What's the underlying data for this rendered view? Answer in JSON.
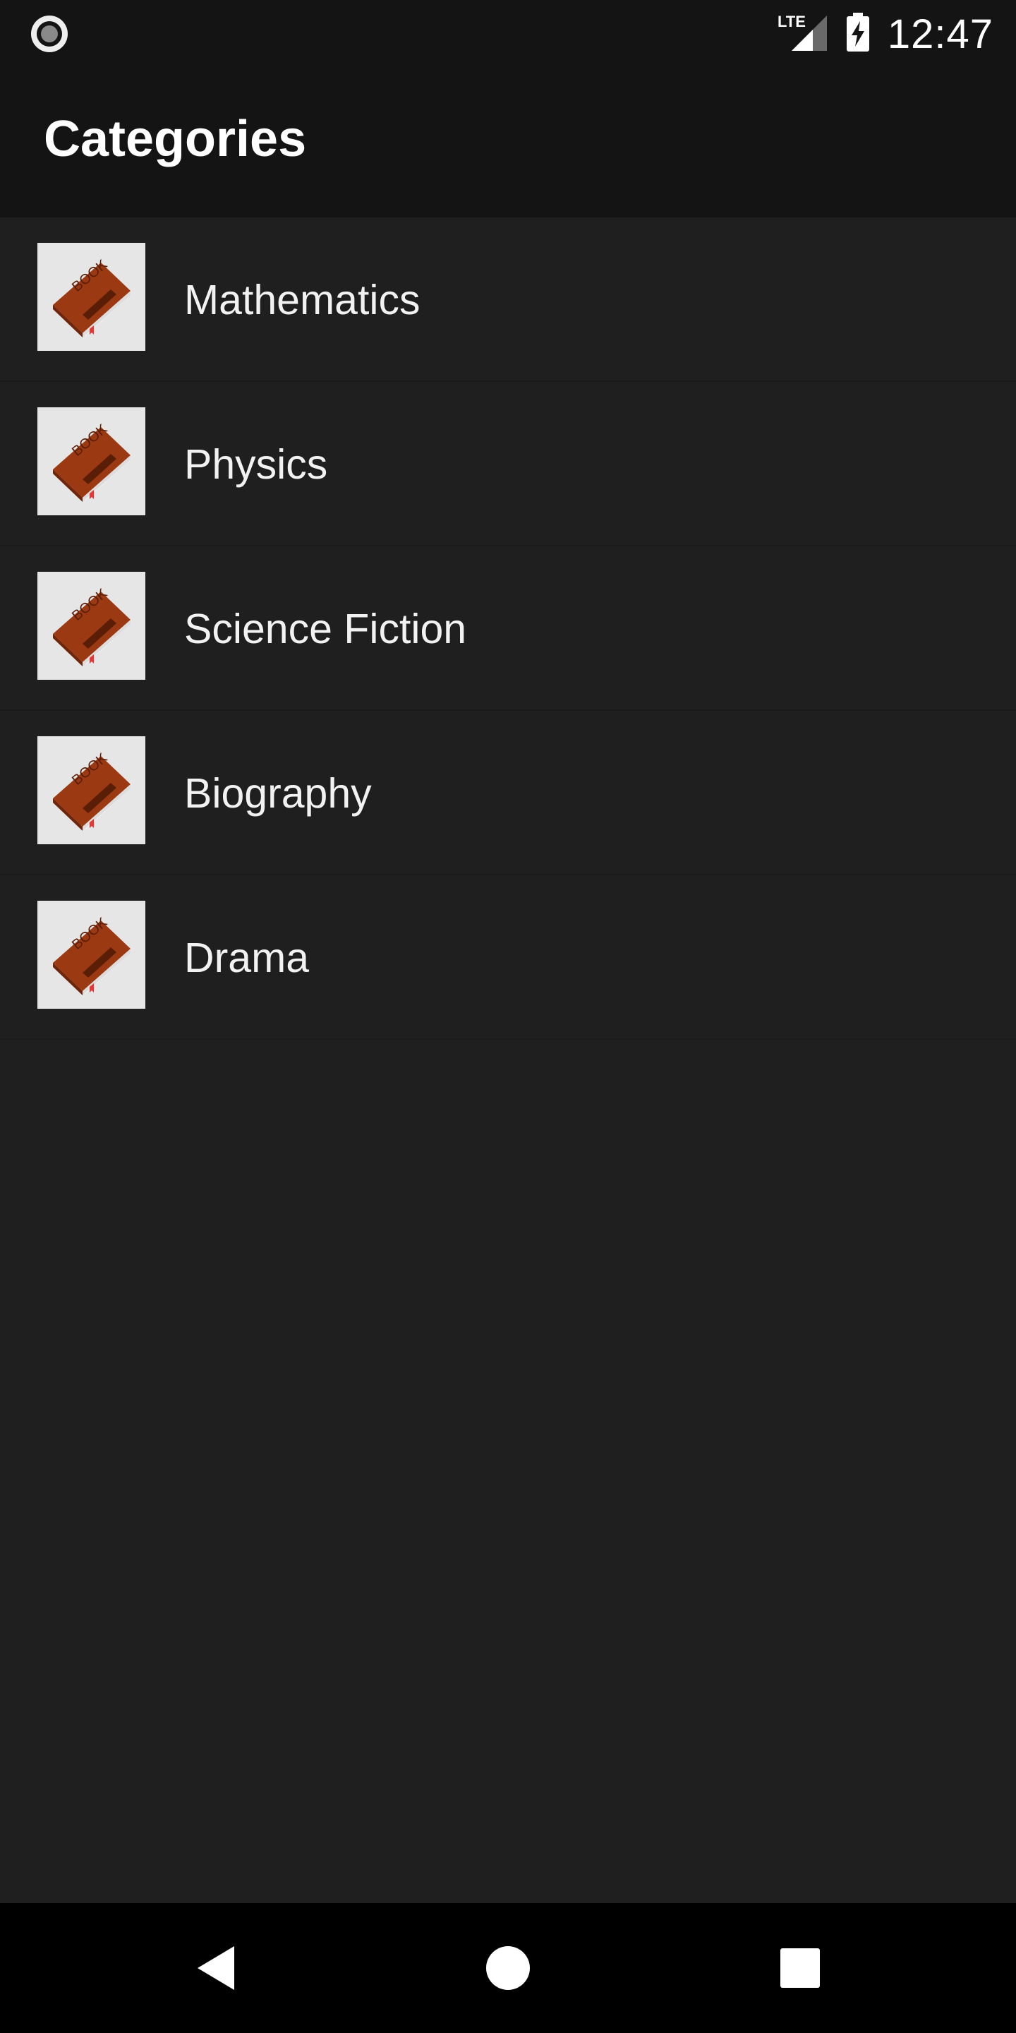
{
  "status_bar": {
    "time": "12:47",
    "network": "LTE",
    "icons": [
      "record-icon",
      "lte-signal-icon",
      "battery-charging-icon"
    ]
  },
  "app_bar": {
    "title": "Categories"
  },
  "categories": [
    {
      "label": "Mathematics",
      "icon": "book-icon"
    },
    {
      "label": "Physics",
      "icon": "book-icon"
    },
    {
      "label": "Science Fiction",
      "icon": "book-icon"
    },
    {
      "label": "Biography",
      "icon": "book-icon"
    },
    {
      "label": "Drama",
      "icon": "book-icon"
    }
  ],
  "nav_bar": {
    "icons": [
      "back-icon",
      "home-icon",
      "recents-icon"
    ]
  },
  "colors": {
    "bars": "#141414",
    "background": "#1f1f1f",
    "nav": "#000000",
    "book": "#9b3a12"
  }
}
